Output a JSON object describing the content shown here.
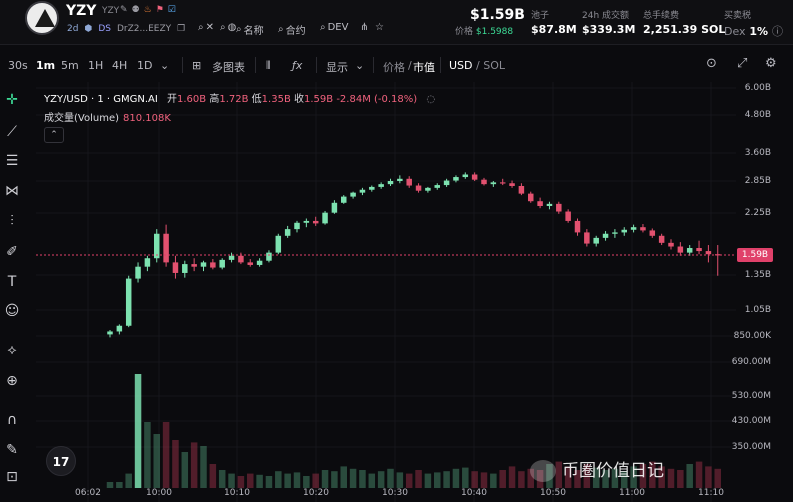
{
  "token": {
    "name": "YZY",
    "symbol": "YZY",
    "age": "2d",
    "dex_badge": "DS",
    "contract_short": "DrZ2...EEZY",
    "actions": [
      "名称",
      "合约",
      "DEV"
    ]
  },
  "stats": {
    "price_usd": "$1.59B",
    "price_label": "价格",
    "price_native": "$1.5988",
    "pool_label": "池子",
    "pool": "$87.8M",
    "volume_label": "24h 成交额",
    "volume": "$339.3M",
    "fees_label": "总手续费",
    "fees": "2,251.39 SOL",
    "tax_label": "买卖税",
    "tax_dex": "Dex",
    "tax": "1%"
  },
  "toolbar": {
    "timeframes": [
      "30s",
      "1m",
      "5m",
      "1H",
      "4H",
      "1D"
    ],
    "active_timeframe": "1m",
    "multi_chart": "多图表",
    "display": "显示",
    "price_mcap_a": "价格",
    "price_mcap_b": "市值",
    "usd": "USD",
    "sol": "SOL"
  },
  "legend": {
    "pair": "YZY/USD · 1 · GMGN.AI",
    "open_label": "开",
    "open": "1.60B",
    "high_label": "高",
    "high": "1.72B",
    "low_label": "低",
    "low": "1.35B",
    "close_label": "收",
    "close": "1.59B",
    "change": "-2.84M (-0.18%)",
    "volume_label": "成交量(Volume)",
    "volume": "810.108K"
  },
  "watermark": "币圈价值日记",
  "colors": {
    "up": "#7de2b0",
    "down": "#e2516f",
    "price_line": "#e0416a"
  },
  "chart_data": {
    "type": "candlestick",
    "y_axis_ticks": [
      "6.00B",
      "4.80B",
      "3.60B",
      "2.85B",
      "2.25B",
      "1.35B",
      "1.05B",
      "850.00K",
      "690.00M",
      "530.00M",
      "430.00M",
      "350.00M"
    ],
    "current_price_label": "1.59B",
    "x_axis_ticks": [
      "06:02",
      "10:00",
      "10:10",
      "10:20",
      "10:30",
      "10:40",
      "10:50",
      "11:00",
      "11:10"
    ],
    "y_scale": "log",
    "grid": true,
    "candles": [
      {
        "o": 0.85,
        "h": 0.88,
        "l": 0.83,
        "c": 0.87
      },
      {
        "o": 0.87,
        "h": 0.92,
        "l": 0.85,
        "c": 0.91
      },
      {
        "o": 0.91,
        "h": 1.35,
        "l": 0.9,
        "c": 1.32
      },
      {
        "o": 1.32,
        "h": 1.5,
        "l": 1.28,
        "c": 1.45
      },
      {
        "o": 1.45,
        "h": 1.58,
        "l": 1.4,
        "c": 1.55
      },
      {
        "o": 1.55,
        "h": 1.95,
        "l": 1.5,
        "c": 1.88
      },
      {
        "o": 1.88,
        "h": 2.02,
        "l": 1.45,
        "c": 1.5
      },
      {
        "o": 1.5,
        "h": 1.58,
        "l": 1.32,
        "c": 1.38
      },
      {
        "o": 1.38,
        "h": 1.52,
        "l": 1.33,
        "c": 1.48
      },
      {
        "o": 1.48,
        "h": 1.55,
        "l": 1.4,
        "c": 1.45
      },
      {
        "o": 1.45,
        "h": 1.52,
        "l": 1.4,
        "c": 1.5
      },
      {
        "o": 1.5,
        "h": 1.54,
        "l": 1.42,
        "c": 1.44
      },
      {
        "o": 1.44,
        "h": 1.55,
        "l": 1.42,
        "c": 1.53
      },
      {
        "o": 1.53,
        "h": 1.62,
        "l": 1.5,
        "c": 1.58
      },
      {
        "o": 1.58,
        "h": 1.62,
        "l": 1.48,
        "c": 1.5
      },
      {
        "o": 1.5,
        "h": 1.54,
        "l": 1.45,
        "c": 1.47
      },
      {
        "o": 1.47,
        "h": 1.55,
        "l": 1.45,
        "c": 1.52
      },
      {
        "o": 1.52,
        "h": 1.65,
        "l": 1.5,
        "c": 1.62
      },
      {
        "o": 1.62,
        "h": 1.88,
        "l": 1.6,
        "c": 1.85
      },
      {
        "o": 1.85,
        "h": 2.0,
        "l": 1.82,
        "c": 1.95
      },
      {
        "o": 1.95,
        "h": 2.08,
        "l": 1.9,
        "c": 2.05
      },
      {
        "o": 2.05,
        "h": 2.12,
        "l": 1.98,
        "c": 2.08
      },
      {
        "o": 2.08,
        "h": 2.15,
        "l": 2.0,
        "c": 2.04
      },
      {
        "o": 2.04,
        "h": 2.25,
        "l": 2.02,
        "c": 2.22
      },
      {
        "o": 2.22,
        "h": 2.45,
        "l": 2.2,
        "c": 2.4
      },
      {
        "o": 2.4,
        "h": 2.55,
        "l": 2.38,
        "c": 2.52
      },
      {
        "o": 2.52,
        "h": 2.62,
        "l": 2.48,
        "c": 2.6
      },
      {
        "o": 2.6,
        "h": 2.7,
        "l": 2.55,
        "c": 2.66
      },
      {
        "o": 2.66,
        "h": 2.75,
        "l": 2.62,
        "c": 2.72
      },
      {
        "o": 2.72,
        "h": 2.82,
        "l": 2.68,
        "c": 2.78
      },
      {
        "o": 2.78,
        "h": 2.9,
        "l": 2.74,
        "c": 2.85
      },
      {
        "o": 2.85,
        "h": 2.98,
        "l": 2.8,
        "c": 2.9
      },
      {
        "o": 2.9,
        "h": 2.96,
        "l": 2.7,
        "c": 2.75
      },
      {
        "o": 2.75,
        "h": 2.8,
        "l": 2.6,
        "c": 2.64
      },
      {
        "o": 2.64,
        "h": 2.72,
        "l": 2.6,
        "c": 2.7
      },
      {
        "o": 2.7,
        "h": 2.8,
        "l": 2.66,
        "c": 2.76
      },
      {
        "o": 2.76,
        "h": 2.9,
        "l": 2.72,
        "c": 2.86
      },
      {
        "o": 2.86,
        "h": 2.98,
        "l": 2.82,
        "c": 2.94
      },
      {
        "o": 2.94,
        "h": 3.05,
        "l": 2.9,
        "c": 3.0
      },
      {
        "o": 3.0,
        "h": 3.05,
        "l": 2.85,
        "c": 2.88
      },
      {
        "o": 2.88,
        "h": 2.92,
        "l": 2.75,
        "c": 2.78
      },
      {
        "o": 2.78,
        "h": 2.85,
        "l": 2.72,
        "c": 2.82
      },
      {
        "o": 2.82,
        "h": 2.9,
        "l": 2.76,
        "c": 2.8
      },
      {
        "o": 2.8,
        "h": 2.86,
        "l": 2.7,
        "c": 2.74
      },
      {
        "o": 2.74,
        "h": 2.8,
        "l": 2.55,
        "c": 2.58
      },
      {
        "o": 2.58,
        "h": 2.62,
        "l": 2.4,
        "c": 2.43
      },
      {
        "o": 2.43,
        "h": 2.5,
        "l": 2.3,
        "c": 2.34
      },
      {
        "o": 2.34,
        "h": 2.42,
        "l": 2.28,
        "c": 2.38
      },
      {
        "o": 2.38,
        "h": 2.42,
        "l": 2.2,
        "c": 2.24
      },
      {
        "o": 2.24,
        "h": 2.28,
        "l": 2.05,
        "c": 2.08
      },
      {
        "o": 2.08,
        "h": 2.12,
        "l": 1.85,
        "c": 1.9
      },
      {
        "o": 1.9,
        "h": 1.95,
        "l": 1.7,
        "c": 1.74
      },
      {
        "o": 1.74,
        "h": 1.85,
        "l": 1.7,
        "c": 1.82
      },
      {
        "o": 1.82,
        "h": 1.92,
        "l": 1.78,
        "c": 1.88
      },
      {
        "o": 1.88,
        "h": 1.95,
        "l": 1.82,
        "c": 1.9
      },
      {
        "o": 1.9,
        "h": 1.98,
        "l": 1.85,
        "c": 1.94
      },
      {
        "o": 1.94,
        "h": 2.02,
        "l": 1.9,
        "c": 1.98
      },
      {
        "o": 1.98,
        "h": 2.03,
        "l": 1.9,
        "c": 1.93
      },
      {
        "o": 1.93,
        "h": 1.96,
        "l": 1.82,
        "c": 1.85
      },
      {
        "o": 1.85,
        "h": 1.88,
        "l": 1.72,
        "c": 1.75
      },
      {
        "o": 1.75,
        "h": 1.8,
        "l": 1.66,
        "c": 1.7
      },
      {
        "o": 1.7,
        "h": 1.76,
        "l": 1.58,
        "c": 1.62
      },
      {
        "o": 1.62,
        "h": 1.72,
        "l": 1.58,
        "c": 1.68
      },
      {
        "o": 1.68,
        "h": 1.78,
        "l": 1.6,
        "c": 1.64
      },
      {
        "o": 1.64,
        "h": 1.72,
        "l": 1.5,
        "c": 1.6
      },
      {
        "o": 1.6,
        "h": 1.72,
        "l": 1.35,
        "c": 1.59
      }
    ],
    "volumes": [
      0.05,
      0.05,
      0.12,
      0.95,
      0.55,
      0.45,
      0.55,
      0.4,
      0.3,
      0.38,
      0.35,
      0.2,
      0.15,
      0.12,
      0.1,
      0.12,
      0.11,
      0.1,
      0.14,
      0.12,
      0.13,
      0.1,
      0.12,
      0.15,
      0.14,
      0.18,
      0.16,
      0.15,
      0.12,
      0.14,
      0.16,
      0.13,
      0.12,
      0.15,
      0.12,
      0.13,
      0.14,
      0.16,
      0.17,
      0.14,
      0.13,
      0.12,
      0.15,
      0.18,
      0.14,
      0.16,
      0.15,
      0.2,
      0.22,
      0.18,
      0.15,
      0.2,
      0.17,
      0.15,
      0.16,
      0.14,
      0.18,
      0.2,
      0.22,
      0.18,
      0.16,
      0.15,
      0.2,
      0.22,
      0.18,
      0.16
    ]
  }
}
